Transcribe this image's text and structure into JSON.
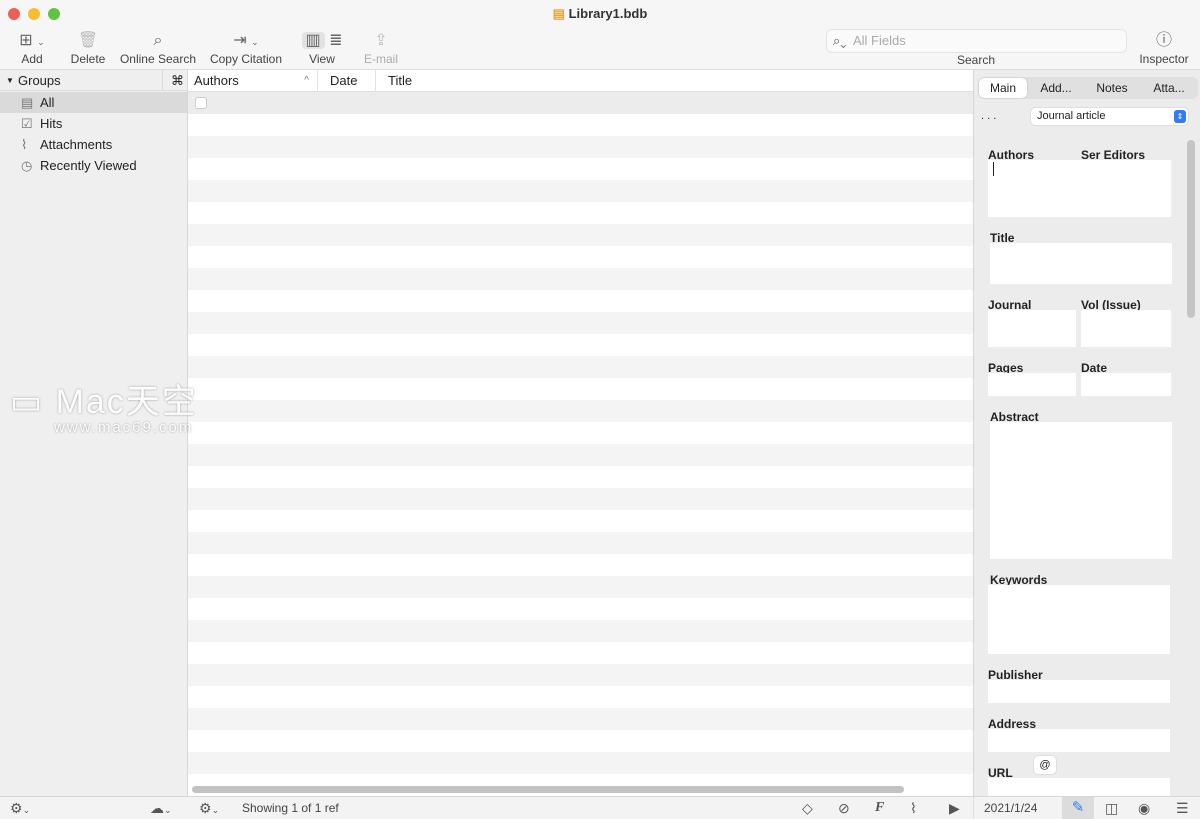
{
  "window": {
    "title": "Library1.bdb"
  },
  "toolbar": {
    "add": "Add",
    "delete": "Delete",
    "online_search": "Online Search",
    "copy_citation": "Copy Citation",
    "view": "View",
    "email": "E-mail",
    "search_placeholder": "All Fields",
    "search_label": "Search",
    "inspector": "Inspector"
  },
  "sidebar": {
    "header": "Groups",
    "header_icon": "⌘",
    "items": [
      {
        "label": "All",
        "icon": "library-icon"
      },
      {
        "label": "Hits",
        "icon": "checkbox-icon"
      },
      {
        "label": "Attachments",
        "icon": "paperclip-icon"
      },
      {
        "label": "Recently Viewed",
        "icon": "clock-icon"
      }
    ]
  },
  "table": {
    "columns": [
      "Authors",
      "Date",
      "Title"
    ],
    "rows": 1
  },
  "inspector": {
    "tabs": [
      "Main",
      "Add...",
      "Notes",
      "Atta..."
    ],
    "dots": ". . .",
    "type": "Journal article",
    "fields": {
      "authors": "Authors",
      "ser_editors": "Ser Editors",
      "title": "Title",
      "journal": "Journal",
      "vol": "Vol (Issue)",
      "pages": "Pages",
      "date": "Date",
      "abstract": "Abstract",
      "keywords": "Keywords",
      "publisher": "Publisher",
      "address": "Address",
      "url": "URL",
      "url_button": "@"
    }
  },
  "status": {
    "text": "Showing 1 of 1 ref",
    "date": "2021/1/24"
  },
  "watermark": {
    "line1": "Mac天空",
    "line2": "www.mac69.com"
  },
  "colors": {
    "accent": "#2f7cf6"
  }
}
